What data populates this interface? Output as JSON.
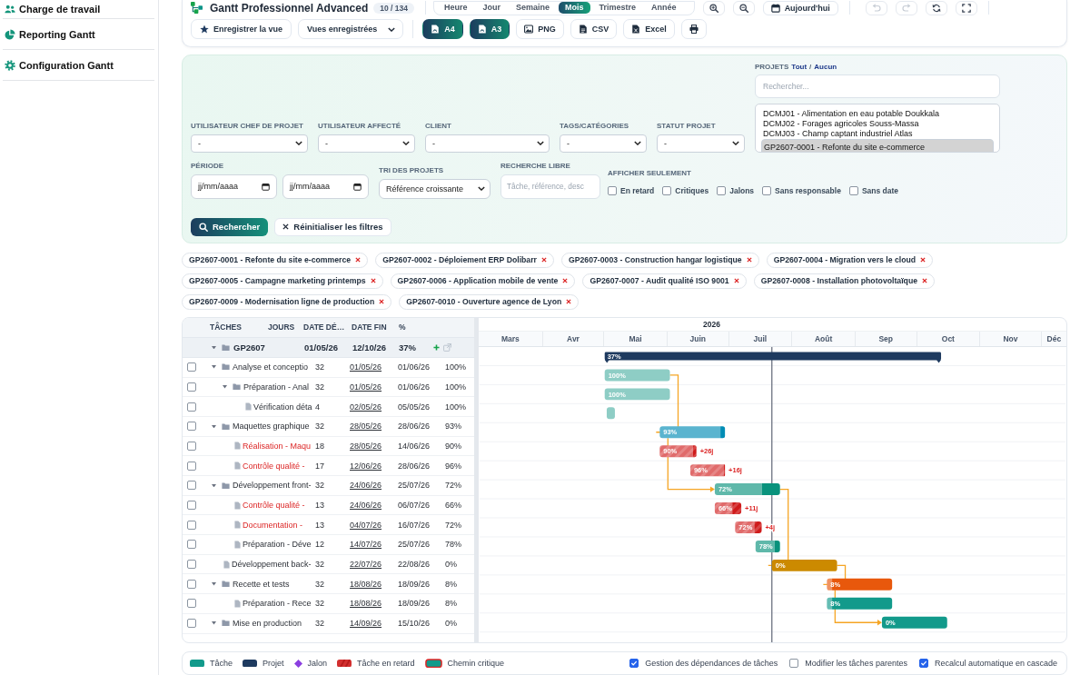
{
  "sidebar": {
    "items": [
      {
        "label": "Charge de travail"
      },
      {
        "label": "Reporting Gantt"
      },
      {
        "label": "Configuration Gantt"
      }
    ]
  },
  "toolbar": {
    "title": "Gantt Professionnel Advanced",
    "count": "10 / 134",
    "view_modes": [
      {
        "label": "Heure",
        "selected": false
      },
      {
        "label": "Jour",
        "selected": false
      },
      {
        "label": "Semaine",
        "selected": false
      },
      {
        "label": "Mois",
        "selected": true
      },
      {
        "label": "Trimestre",
        "selected": false
      },
      {
        "label": "Année",
        "selected": false
      }
    ],
    "today_button": "Aujourd'hui",
    "undo": {
      "disabled": true
    },
    "redo": {
      "disabled": true
    },
    "save_view_button": "Enregistrer la vue",
    "saved_views": {
      "value": "Vues enregistrées"
    },
    "exports": [
      {
        "label": "A4",
        "kind": "pdf"
      },
      {
        "label": "A3",
        "kind": "pdf"
      },
      {
        "label": "PNG",
        "kind": "image"
      },
      {
        "label": "CSV",
        "kind": "csv"
      },
      {
        "label": "Excel",
        "kind": "excel"
      }
    ]
  },
  "filters": {
    "selects": [
      {
        "label": "UTILISATEUR CHEF DE PROJET",
        "value": "-"
      },
      {
        "label": "UTILISATEUR AFFECTÉ",
        "value": "-"
      },
      {
        "label": "CLIENT",
        "value": "-"
      },
      {
        "label": "TAGS/CATÉGORIES",
        "value": "-"
      },
      {
        "label": "STATUT PROJET",
        "value": "-"
      }
    ],
    "projects": {
      "label": "PROJETS",
      "all_link": "Tout",
      "separator": "/",
      "none_link": "Aucun",
      "search": {
        "placeholder": "Rechercher..."
      },
      "options": [
        {
          "label": "DCMJ01 - Alimentation en eau potable Doukkala",
          "selected": false
        },
        {
          "label": "DCMJ02 - Forages agricoles Souss-Massa",
          "selected": false
        },
        {
          "label": "DCMJ03 - Champ captant industriel Atlas",
          "selected": false
        },
        {
          "label": "GP2607-0001 - Refonte du site e-commerce",
          "selected": true
        }
      ]
    },
    "period": {
      "label": "PÉRIODE",
      "from": {
        "placeholder": "jj/mm/aaaa"
      },
      "to": {
        "placeholder": "jj/mm/aaaa"
      }
    },
    "sort": {
      "label": "TRI DES PROJETS",
      "value": "Référence croissante"
    },
    "free_search": {
      "label": "RECHERCHE LIBRE",
      "placeholder": "Tâche, référence, desc"
    },
    "show_only": {
      "label": "AFFICHER SEULEMENT",
      "options": [
        {
          "label": "En retard",
          "checked": false
        },
        {
          "label": "Critiques",
          "checked": false
        },
        {
          "label": "Jalons",
          "checked": false
        },
        {
          "label": "Sans responsable",
          "checked": false
        },
        {
          "label": "Sans date",
          "checked": false
        }
      ]
    },
    "search_button": "Rechercher",
    "reset_button": "Réinitialiser les filtres"
  },
  "selected_projects": [
    "GP2607-0001 - Refonte du site e-commerce",
    "GP2607-0002 - Déploiement ERP Dolibarr",
    "GP2607-0003 - Construction hangar logistique",
    "GP2607-0004 - Migration vers le cloud",
    "GP2607-0005 - Campagne marketing printemps",
    "GP2607-0006 - Application mobile de vente",
    "GP2607-0007 - Audit qualité ISO 9001",
    "GP2607-0008 - Installation photovoltaïque",
    "GP2607-0009 - Modernisation ligne de production",
    "GP2607-0010 - Ouverture agence de Lyon"
  ],
  "gantt": {
    "columns": [
      "TÂCHES",
      "JOURS",
      "DATE DÉ…",
      "DATE FIN",
      "%"
    ],
    "timeline": {
      "year": "2026",
      "months": [
        "Mars",
        "Avr",
        "Mai",
        "Juin",
        "Juil",
        "Août",
        "Sep",
        "Oct",
        "Nov",
        "Déc"
      ]
    },
    "project": {
      "name": "GP2607",
      "expanded": true,
      "start": "01/05/26",
      "end": "12/10/26",
      "progress": "37%",
      "bar_label": "37%"
    },
    "tasks": [
      {
        "kind": "group",
        "expanded": true,
        "checked": false,
        "late": false,
        "name": "Analyse et conceptio",
        "days": "32",
        "start": "01/05/26",
        "end": "01/06/26",
        "progress": "100%",
        "bar_label": "100%",
        "level": 1,
        "color": "#8ecdc5",
        "children": [
          {
            "kind": "group",
            "expanded": true,
            "checked": false,
            "late": false,
            "name": "Préparation - Anal",
            "days": "32",
            "start": "01/05/26",
            "end": "01/06/26",
            "progress": "100%",
            "bar_label": "100%",
            "level": 1,
            "color": "#8ecdc5",
            "children": [
              {
                "kind": "task",
                "checked": false,
                "late": false,
                "name": "Vérification déta",
                "days": "4",
                "start": "02/05/26",
                "end": "05/05/26",
                "progress": "100%",
                "level": 1,
                "color": "#8ecdc5"
              }
            ]
          }
        ]
      },
      {
        "kind": "group",
        "expanded": true,
        "checked": false,
        "late": false,
        "name": "Maquettes graphique",
        "days": "32",
        "start": "28/05/26",
        "end": "28/06/26",
        "progress": "93%",
        "bar_label": "93%",
        "level": 0.93,
        "color": "#5ab4cf",
        "children": [
          {
            "kind": "task",
            "checked": false,
            "late": true,
            "name": "Réalisation - Maqu",
            "days": "18",
            "start": "28/05/26",
            "end": "14/06/26",
            "progress": "90%",
            "bar_label": "90%",
            "delay": "+26j",
            "level": 0.9,
            "color": "#e06b6b"
          },
          {
            "kind": "task",
            "checked": false,
            "late": true,
            "name": "Contrôle qualité -",
            "days": "17",
            "start": "12/06/26",
            "end": "28/06/26",
            "progress": "96%",
            "bar_label": "96%",
            "delay": "+16j",
            "level": 0.96,
            "color": "#e06b6b"
          }
        ]
      },
      {
        "kind": "group",
        "expanded": true,
        "checked": false,
        "late": false,
        "name": "Développement front-",
        "days": "32",
        "start": "24/06/26",
        "end": "25/07/26",
        "progress": "72%",
        "bar_label": "72%",
        "level": 0.72,
        "color": "#5fb8aa",
        "children": [
          {
            "kind": "task",
            "checked": false,
            "late": true,
            "name": "Contrôle qualité -",
            "days": "13",
            "start": "24/06/26",
            "end": "06/07/26",
            "progress": "66%",
            "bar_label": "66%",
            "delay": "+11j",
            "level": 0.66,
            "color": "#e06b6b"
          },
          {
            "kind": "task",
            "checked": false,
            "late": true,
            "name": "Documentation -",
            "days": "13",
            "start": "04/07/26",
            "end": "16/07/26",
            "progress": "72%",
            "bar_label": "72%",
            "delay": "+4j",
            "level": 0.72,
            "color": "#e06b6b"
          },
          {
            "kind": "task",
            "checked": false,
            "late": false,
            "name": "Préparation - Déve",
            "days": "12",
            "start": "14/07/26",
            "end": "25/07/26",
            "progress": "78%",
            "bar_label": "78%",
            "level": 0.78,
            "color": "#5fb8aa"
          }
        ]
      },
      {
        "kind": "task",
        "checked": false,
        "late": false,
        "name": "Développement back-",
        "days": "32",
        "start": "22/07/26",
        "end": "22/08/26",
        "progress": "0%",
        "bar_label": "0%",
        "level": 0,
        "color": "#cc8a00"
      },
      {
        "kind": "group",
        "expanded": true,
        "checked": false,
        "late": false,
        "name": "Recette et tests",
        "days": "32",
        "start": "18/08/26",
        "end": "18/09/26",
        "progress": "8%",
        "bar_label": "8%",
        "level": 0.08,
        "color": "#e8580c",
        "children": [
          {
            "kind": "task",
            "checked": false,
            "late": false,
            "name": "Préparation - Rece",
            "days": "32",
            "start": "18/08/26",
            "end": "18/09/26",
            "progress": "8%",
            "bar_label": "8%",
            "level": 0.08,
            "color": "#129a8b"
          }
        ]
      },
      {
        "kind": "group",
        "expanded": true,
        "checked": false,
        "late": false,
        "name": "Mise en production",
        "days": "32",
        "start": "14/09/26",
        "end": "15/10/26",
        "progress": "0%",
        "bar_label": "0%",
        "level": 0,
        "color": "#129a8b"
      }
    ]
  },
  "legend": {
    "items": [
      {
        "kind": "task",
        "label": "Tâche"
      },
      {
        "kind": "project",
        "label": "Projet"
      },
      {
        "kind": "milestone",
        "label": "Jalon"
      },
      {
        "kind": "late",
        "label": "Tâche en retard"
      },
      {
        "kind": "critical",
        "label": "Chemin critique"
      }
    ],
    "options": [
      {
        "label": "Gestion des dépendances de tâches",
        "checked": true
      },
      {
        "label": "Modifier les tâches parentes",
        "checked": false
      },
      {
        "label": "Recalcul automatique en cascade",
        "checked": true
      }
    ]
  }
}
